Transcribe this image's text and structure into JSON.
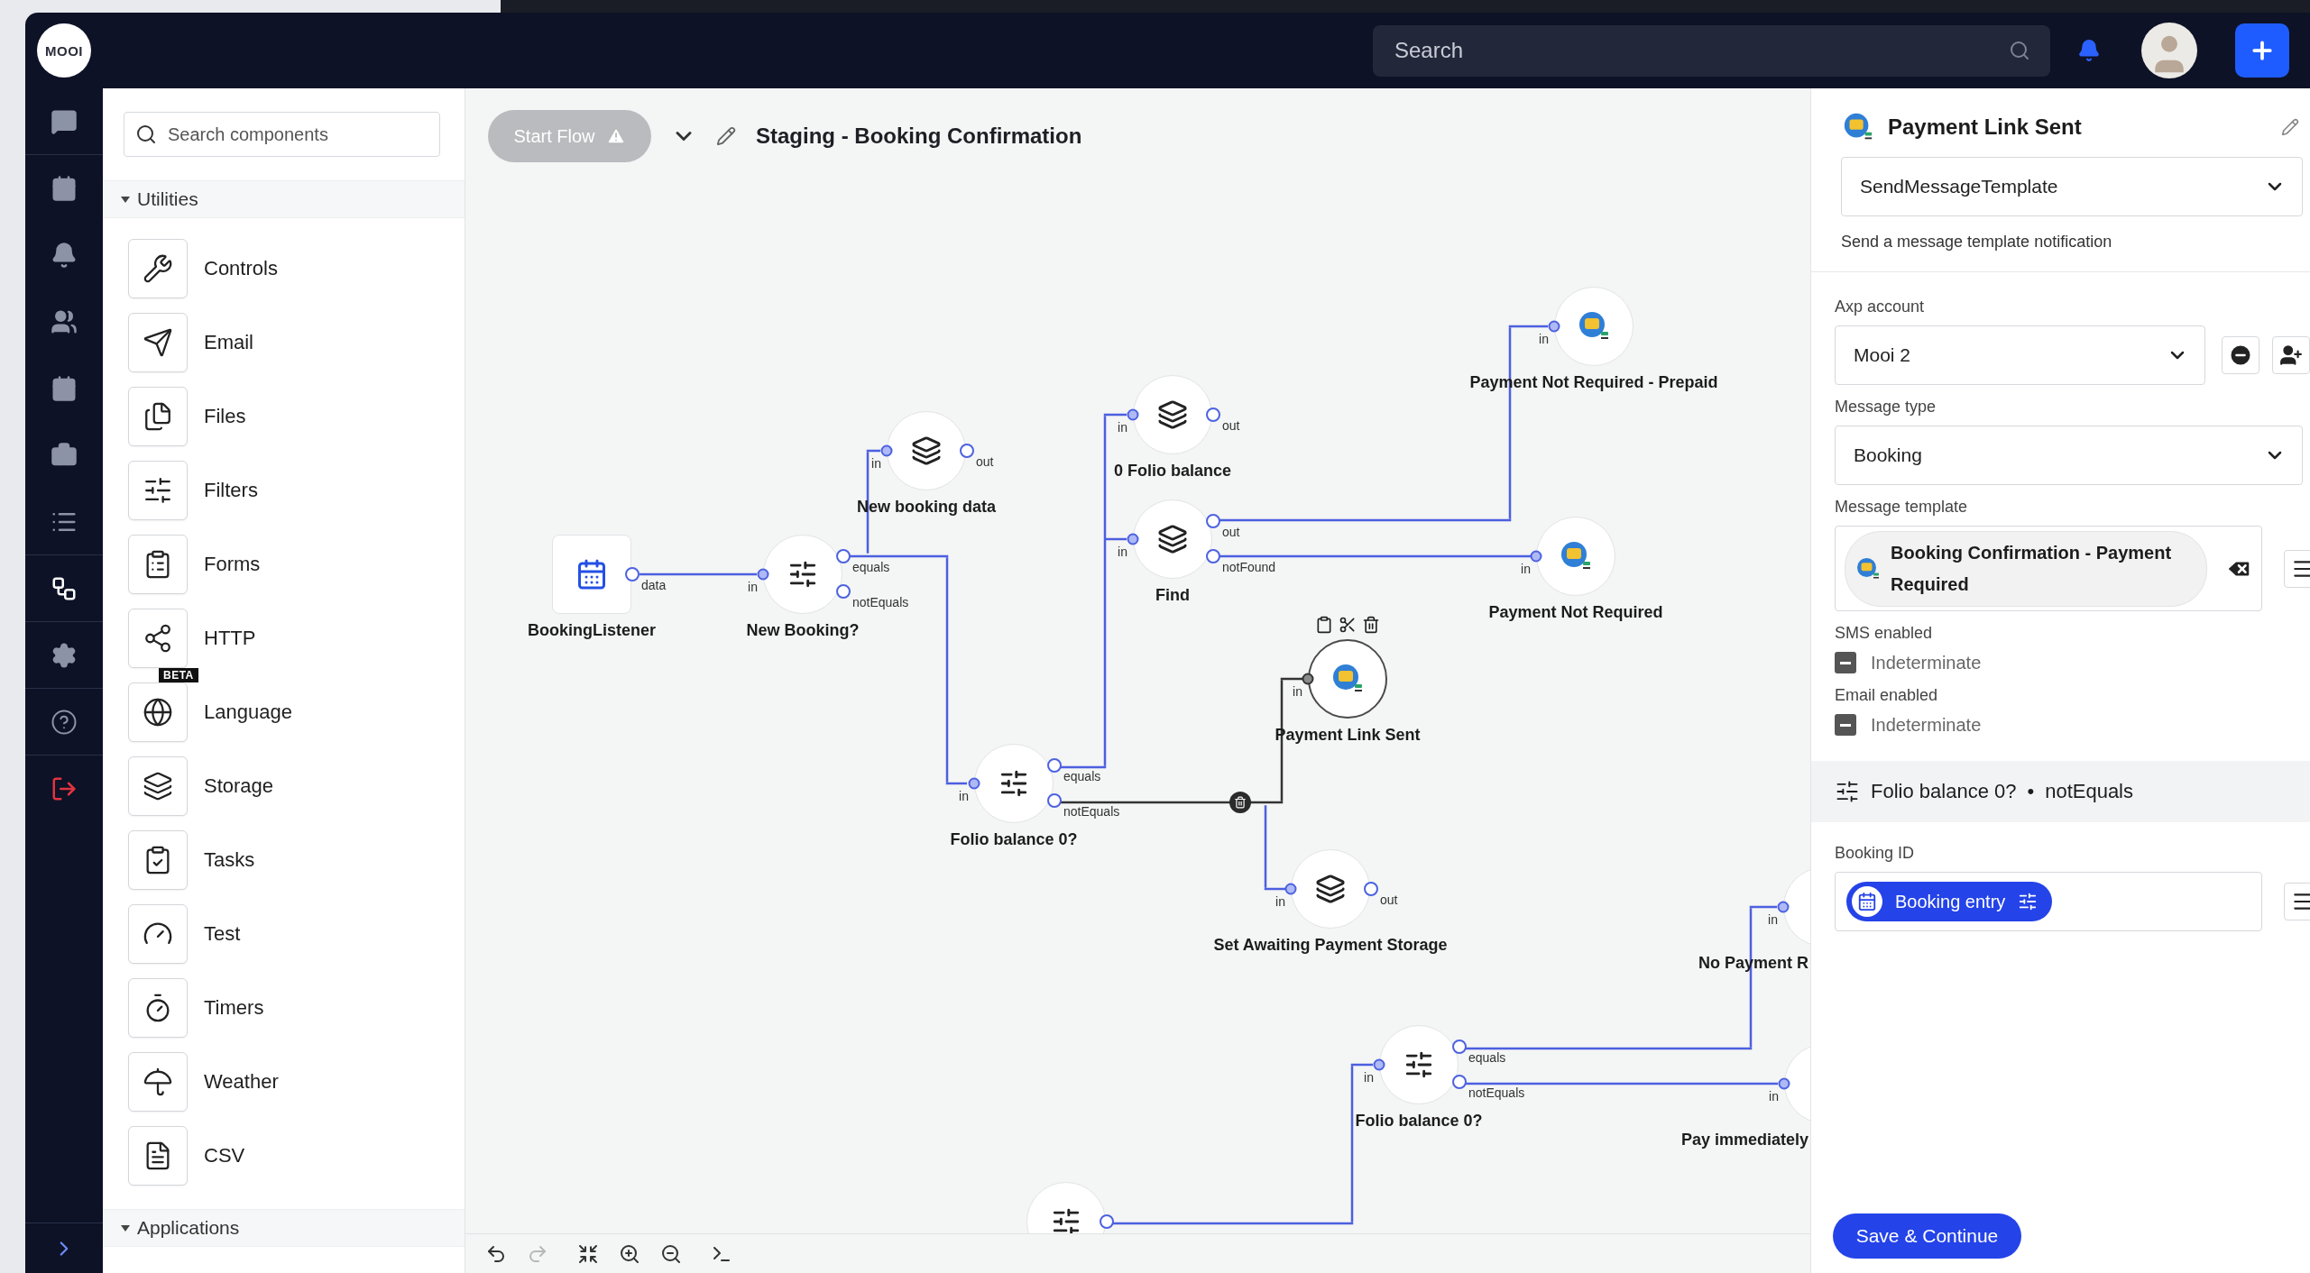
{
  "topbar": {
    "logo": "MOOI",
    "search": {
      "placeholder": "Search"
    }
  },
  "nav": [
    {
      "selected": false
    },
    {
      "selected": false
    },
    {
      "selected": false
    },
    {
      "selected": false
    },
    {
      "selected": false
    },
    {
      "selected": false
    },
    {
      "selected": false
    },
    {
      "selected": true
    },
    {
      "selected": false
    },
    {
      "selected": false
    },
    {
      "selected": false
    }
  ],
  "components": {
    "search": {
      "placeholder": "Search components"
    },
    "sections": [
      {
        "title": "Utilities",
        "expanded": true,
        "items": [
          {
            "label": "Controls"
          },
          {
            "label": "Email"
          },
          {
            "label": "Files"
          },
          {
            "label": "Filters"
          },
          {
            "label": "Forms"
          },
          {
            "label": "HTTP"
          },
          {
            "label": "Language",
            "badge": "BETA"
          },
          {
            "label": "Storage"
          },
          {
            "label": "Tasks"
          },
          {
            "label": "Test"
          },
          {
            "label": "Timers"
          },
          {
            "label": "Weather"
          },
          {
            "label": "CSV"
          }
        ]
      },
      {
        "title": "Applications",
        "expanded": true
      }
    ]
  },
  "canvas": {
    "start_button": {
      "label": "Start Flow",
      "disabled": true
    },
    "title": "Staging - Booking Confirmation",
    "nodes": [
      {
        "kind": "listener",
        "label": "BookingListener",
        "selected": false,
        "outputs": [
          {
            "label": "data"
          }
        ]
      },
      {
        "kind": "filter",
        "label": "New Booking?",
        "selected": false,
        "inputs": [
          "in"
        ],
        "outputs": [
          {
            "label": "equals"
          },
          {
            "label": "notEquals"
          }
        ]
      },
      {
        "kind": "storage",
        "label": "New booking data",
        "selected": false,
        "inputs": [
          "in"
        ],
        "outputs": [
          {
            "label": "out"
          }
        ]
      },
      {
        "kind": "storage",
        "label": "0 Folio balance",
        "selected": false,
        "inputs": [
          "in"
        ],
        "outputs": [
          {
            "label": "out"
          }
        ]
      },
      {
        "kind": "storage",
        "label": "Find",
        "selected": false,
        "inputs": [
          "in"
        ],
        "outputs": [
          {
            "label": "out"
          },
          {
            "label": "notFound"
          }
        ]
      },
      {
        "kind": "message",
        "label": "Payment Not Required - Prepaid",
        "selected": false,
        "inputs": [
          "in"
        ]
      },
      {
        "kind": "message",
        "label": "Payment Not Required",
        "selected": false,
        "inputs": [
          "in"
        ]
      },
      {
        "kind": "message",
        "label": "Payment Link Sent",
        "selected": true,
        "inputs": [
          "in"
        ]
      },
      {
        "kind": "filter",
        "label": "Folio balance 0?",
        "selected": false,
        "inputs": [
          "in"
        ],
        "outputs": [
          {
            "label": "equals"
          },
          {
            "label": "notEquals"
          }
        ]
      },
      {
        "kind": "storage",
        "label": "Set Awaiting Payment Storage",
        "selected": false,
        "inputs": [
          "in"
        ],
        "outputs": [
          {
            "label": "out"
          }
        ]
      },
      {
        "kind": "filter",
        "label": "Folio balance 0?",
        "selected": false,
        "inputs": [
          "in"
        ],
        "outputs": [
          {
            "label": "equals"
          },
          {
            "label": "notEquals"
          }
        ]
      },
      {
        "kind": "message",
        "label": "No Payment R",
        "selected": false,
        "inputs": [
          "in"
        ]
      },
      {
        "kind": "message",
        "label": "Pay immediately",
        "selected": false,
        "inputs": [
          "in"
        ]
      },
      {
        "kind": "filter",
        "selected": false
      }
    ],
    "connections": [
      {
        "selected": false
      },
      {
        "selected": false
      },
      {
        "selected": false
      },
      {
        "selected": false
      },
      {
        "selected": false
      },
      {
        "selected": false
      },
      {
        "selected": false
      },
      {
        "selected": true
      },
      {
        "selected": false
      },
      {
        "selected": false
      },
      {
        "selected": false
      },
      {
        "selected": false
      }
    ],
    "toolbar": [
      {
        "disabled": false
      },
      {
        "disabled": true
      },
      {
        "disabled": false
      },
      {
        "disabled": false
      },
      {
        "disabled": false
      },
      {
        "disabled": false
      }
    ]
  },
  "panel": {
    "title": "Payment Link Sent",
    "component": {
      "value": "SendMessageTemplate"
    },
    "description": "Send a message template notification",
    "fields": [
      {
        "kind": "account",
        "label": "Axp account",
        "value": "Mooi 2"
      },
      {
        "kind": "select",
        "label": "Message type",
        "value": "Booking"
      },
      {
        "kind": "template",
        "label": "Message template",
        "value": "Booking Confirmation - Payment Required"
      },
      {
        "kind": "checkbox",
        "label": "SMS enabled",
        "indeterminate": true,
        "text": "Indeterminate"
      },
      {
        "kind": "checkbox",
        "label": "Email enabled",
        "indeterminate": true,
        "text": "Indeterminate"
      }
    ],
    "source": {
      "node": "Folio balance 0?",
      "separator": "•",
      "output": "notEquals"
    },
    "inputs": [
      {
        "label": "Booking ID",
        "value": "Booking entry"
      }
    ],
    "save_button": "Save & Continue"
  }
}
